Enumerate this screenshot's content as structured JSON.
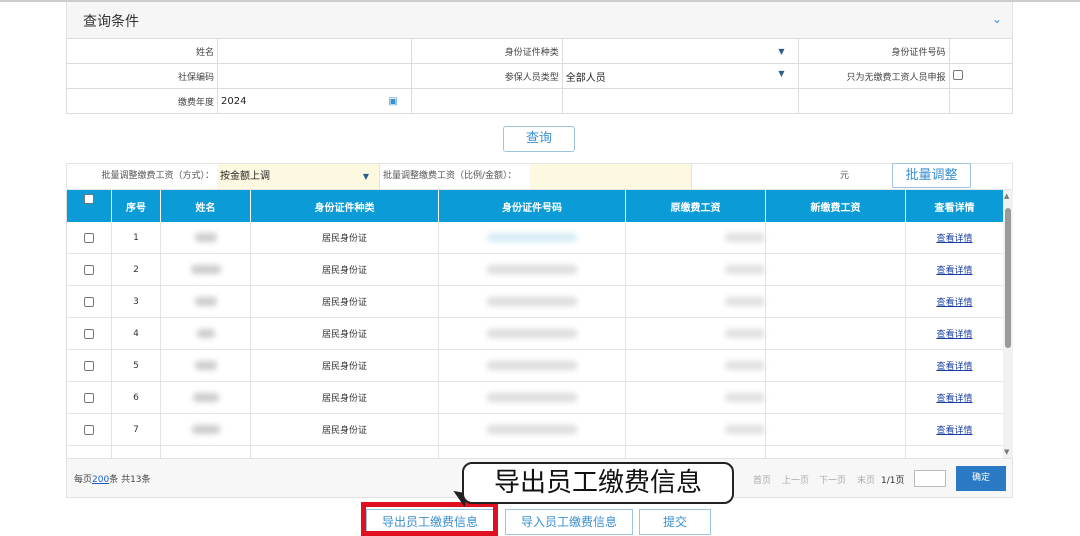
{
  "panel": {
    "title": "查询条件"
  },
  "query": {
    "name_label": "姓名",
    "idtype_label": "身份证件种类",
    "idno_label": "身份证件号码",
    "ssn_label": "社保编码",
    "persontype_label": "参保人员类型",
    "persontype_value": "全部人员",
    "nowage_label": "只为无缴费工资人员申报",
    "year_label": "缴费年度",
    "year_value": "2024",
    "search_button": "查询"
  },
  "batch": {
    "mode_label": "批量调整缴费工资（方式）：",
    "mode_value": "按金额上调",
    "amount_label": "批量调整缴费工资（比例/金额）：",
    "unit": "元",
    "button": "批量调整"
  },
  "table": {
    "headers": [
      "序号",
      "姓名",
      "身份证件种类",
      "身份证件号码",
      "原缴费工资",
      "新缴费工资",
      "查看详情"
    ],
    "rows": [
      {
        "no": "1",
        "idtype": "居民身份证",
        "detail": "查看详情"
      },
      {
        "no": "2",
        "idtype": "居民身份证",
        "detail": "查看详情"
      },
      {
        "no": "3",
        "idtype": "居民身份证",
        "detail": "查看详情"
      },
      {
        "no": "4",
        "idtype": "居民身份证",
        "detail": "查看详情"
      },
      {
        "no": "5",
        "idtype": "居民身份证",
        "detail": "查看详情"
      },
      {
        "no": "6",
        "idtype": "居民身份证",
        "detail": "查看详情"
      },
      {
        "no": "7",
        "idtype": "居民身份证",
        "detail": "查看详情"
      }
    ]
  },
  "pager": {
    "per_page_prefix": "每页",
    "per_page": "200",
    "per_page_suffix": "条 共13条",
    "first": "首页",
    "prev": "上一页",
    "next": "下一页",
    "last": "末页",
    "page_info": "1/1页",
    "ok": "确定"
  },
  "callout": "导出员工缴费信息",
  "actions": {
    "export": "导出员工缴费信息",
    "import": "导入员工缴费信息",
    "submit": "提交"
  }
}
